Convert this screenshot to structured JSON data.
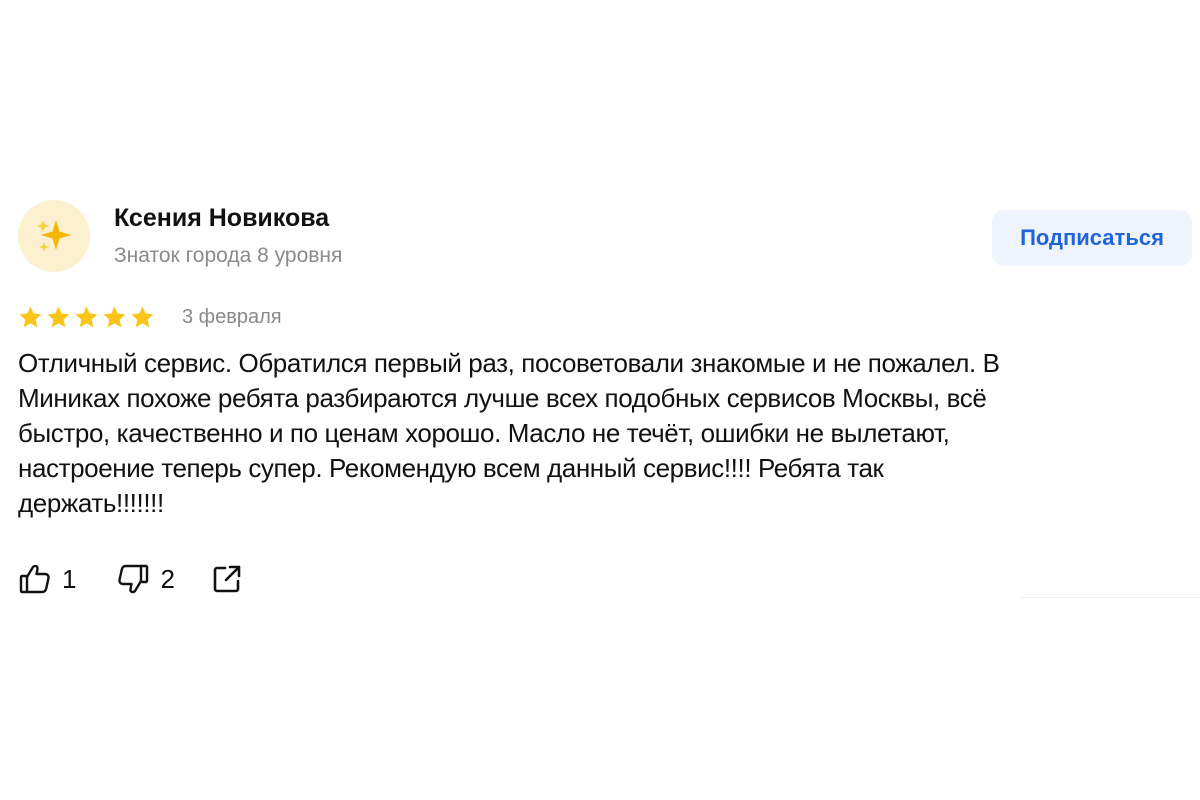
{
  "review": {
    "author": {
      "name": "Ксения Новикова",
      "level": "Знаток города 8 уровня",
      "avatar_icon": "sparkles-icon"
    },
    "subscribe_label": "Подписаться",
    "rating": 5,
    "rating_max": 5,
    "date": "3 февраля",
    "text_lines": [
      "Отличный сервис. Обратился первый раз, посоветовали знакомые и не пожалел. В",
      "Миниках похоже ребята разбираются лучше всех подобных сервисов Москвы, всё",
      "быстро, качественно и по ценам хорошо. Масло не течёт, ошибки не вылетают,",
      "настроение теперь супер. Рекомендую всем данный сервис!!!! Ребята так",
      "держать!!!!!!!"
    ],
    "likes": "1",
    "dislikes": "2"
  },
  "colors": {
    "accent": "#1f64d8",
    "star": "#fcc419",
    "avatar_bg": "#fdf0d0",
    "muted_text": "#8a8a8a"
  }
}
